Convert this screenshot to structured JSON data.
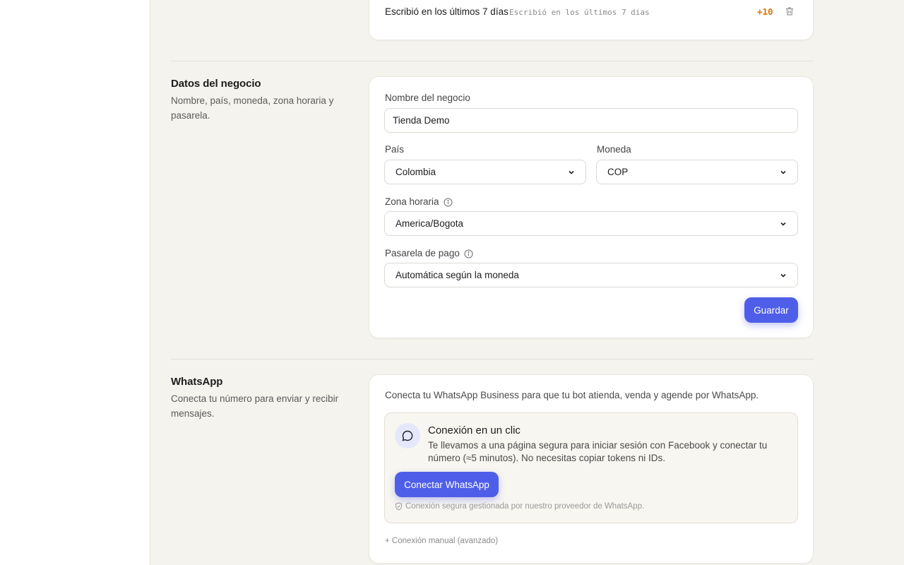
{
  "colors": {
    "accent": "#4f5ee8",
    "badge": "#d97706",
    "background": "#f5f3ee"
  },
  "top_card": {
    "rule_label": "Escribió en los últimos 7 días",
    "rule_code": "Escribió en los últimos 7 días",
    "points": "+10",
    "delete_icon": "trash-icon"
  },
  "business": {
    "title": "Datos del negocio",
    "description": "Nombre, país, moneda, zona horaria y pasarela.",
    "name_label": "Nombre del negocio",
    "name_value": "Tienda Demo",
    "country_label": "País",
    "country_value": "Colombia",
    "currency_label": "Moneda",
    "currency_value": "COP",
    "timezone_label": "Zona horaria",
    "timezone_value": "America/Bogota",
    "gateway_label": "Pasarela de pago",
    "gateway_value": "Automática según la moneda",
    "save_label": "Guardar"
  },
  "whatsapp": {
    "title": "WhatsApp",
    "description": "Conecta tu número para enviar y recibir mensajes.",
    "intro": "Conecta tu WhatsApp Business para que tu bot atienda, venda y agende por WhatsApp.",
    "box_title": "Conexión en un clic",
    "box_text": "Te llevamos a una página segura para iniciar sesión con Facebook y conectar tu número (≈5 minutos). No necesitas copiar tokens ni IDs.",
    "connect_label": "Conectar WhatsApp",
    "secure_note": "Conexión segura gestionada por nuestro proveedor de WhatsApp.",
    "manual_link": "+ Conexión manual (avanzado)"
  }
}
